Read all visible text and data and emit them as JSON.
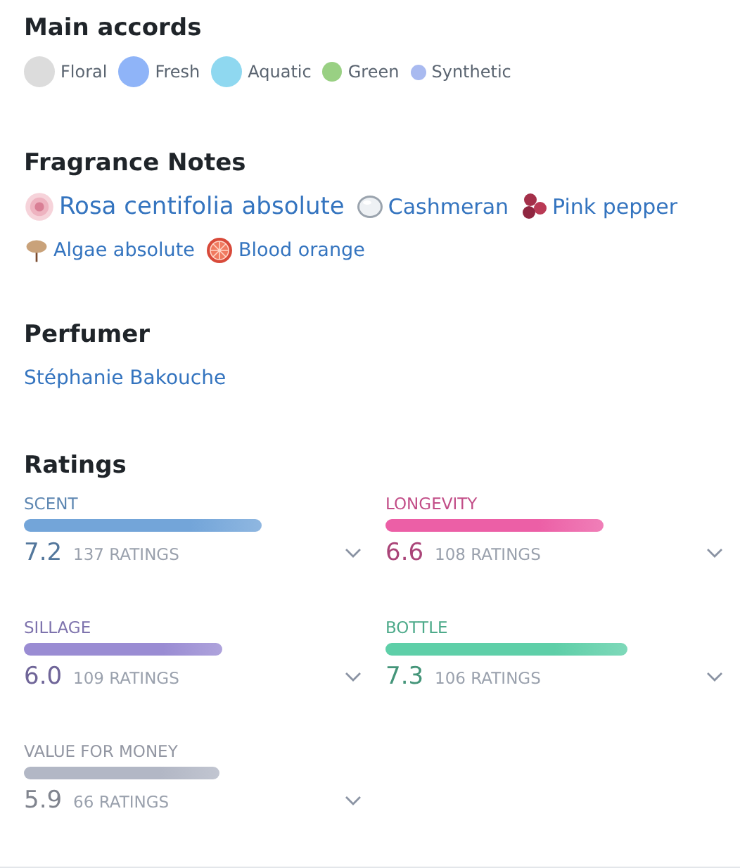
{
  "accords": {
    "title": "Main accords",
    "items": [
      {
        "name": "Floral",
        "color": "#dcdcdc"
      },
      {
        "name": "Fresh",
        "color": "#8fb4f8"
      },
      {
        "name": "Aquatic",
        "color": "#8fd8f0"
      },
      {
        "name": "Green",
        "color": "#99d083"
      },
      {
        "name": "Synthetic",
        "color": "#a9baf0"
      }
    ]
  },
  "notes": {
    "title": "Fragrance Notes",
    "items": [
      {
        "name": "Rosa centifolia absolute",
        "kind": "rose"
      },
      {
        "name": "Cashmeran",
        "kind": "drop"
      },
      {
        "name": "Pink pepper",
        "kind": "berries"
      },
      {
        "name": "Algae absolute",
        "kind": "algae"
      },
      {
        "name": "Blood orange",
        "kind": "orange"
      }
    ]
  },
  "perfumer": {
    "title": "Perfumer",
    "name": "Stéphanie Bakouche"
  },
  "ratings": {
    "title": "Ratings",
    "items": [
      {
        "label": "SCENT",
        "score": "7.2",
        "count": "137 RATINGS",
        "color": "#73a5d9"
      },
      {
        "label": "LONGEVITY",
        "score": "6.6",
        "count": "108 RATINGS",
        "color": "#ec5fa6"
      },
      {
        "label": "SILLAGE",
        "score": "6.0",
        "count": "109 RATINGS",
        "color": "#9a8cd3"
      },
      {
        "label": "BOTTLE",
        "score": "7.3",
        "count": "106 RATINGS",
        "color": "#5ecfa8"
      },
      {
        "label": "VALUE FOR MONEY",
        "score": "5.9",
        "count": "66 RATINGS",
        "color": "#b2b7c5"
      }
    ]
  }
}
